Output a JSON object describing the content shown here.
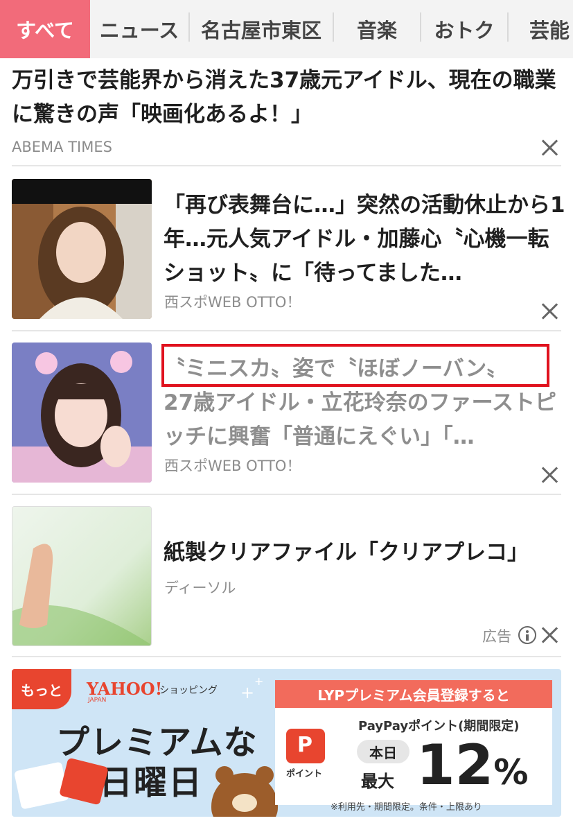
{
  "tabs": [
    {
      "label": "すべて",
      "active": true
    },
    {
      "label": "ニュース",
      "active": false
    },
    {
      "label": "名古屋市東区",
      "active": false
    },
    {
      "label": "音楽",
      "active": false
    },
    {
      "label": "おトク",
      "active": false
    },
    {
      "label": "芸能",
      "active": false
    }
  ],
  "top_article": {
    "headline": "万引きで芸能界から消えた37歳元アイドル、現在の職業に驚きの声「映画化あるよ！」",
    "source": "ABEMA TIMES"
  },
  "cards": [
    {
      "title": "「再び表舞台に…」突然の活動休止から1年…元人気アイドル・加藤心〝心機一転ショット〟に「待ってました…",
      "source": "西スポWEB OTTO！"
    },
    {
      "title_highlighted": "〝ミニスカ〟姿で〝ほぼノーバン〟",
      "title_rest": "27歳アイドル・立花玲奈のファーストピッチに興奮「普通にえぐい」「…",
      "source": "西スポWEB OTTO！"
    },
    {
      "title": "紙製クリアファイル「クリアプレコ」",
      "source": "ディーソル",
      "ad_label": "広告"
    }
  ],
  "banner": {
    "corner_badge": "もっと",
    "brand": "YAHOO!",
    "brand_sub": "JAPAN",
    "brand_shopping": "ショッピング",
    "headline_line1": "プレミアムな",
    "headline_line2": "日曜日",
    "box_header": "LYPプレミアム会員登録すると",
    "paypay_point_caption": "ポイント",
    "paypay_text": "PayPayポイント(期間限定)",
    "today": "本日",
    "max": "最大",
    "percent_value": "12",
    "percent_sign": "%",
    "fine_print": "※利用先・期間限定。条件・上限あり"
  },
  "colors": {
    "accent_tab": "#f26b7a",
    "highlight_box": "#e0121e",
    "banner_bg": "#cfe5f6",
    "banner_red": "#e8452f"
  }
}
